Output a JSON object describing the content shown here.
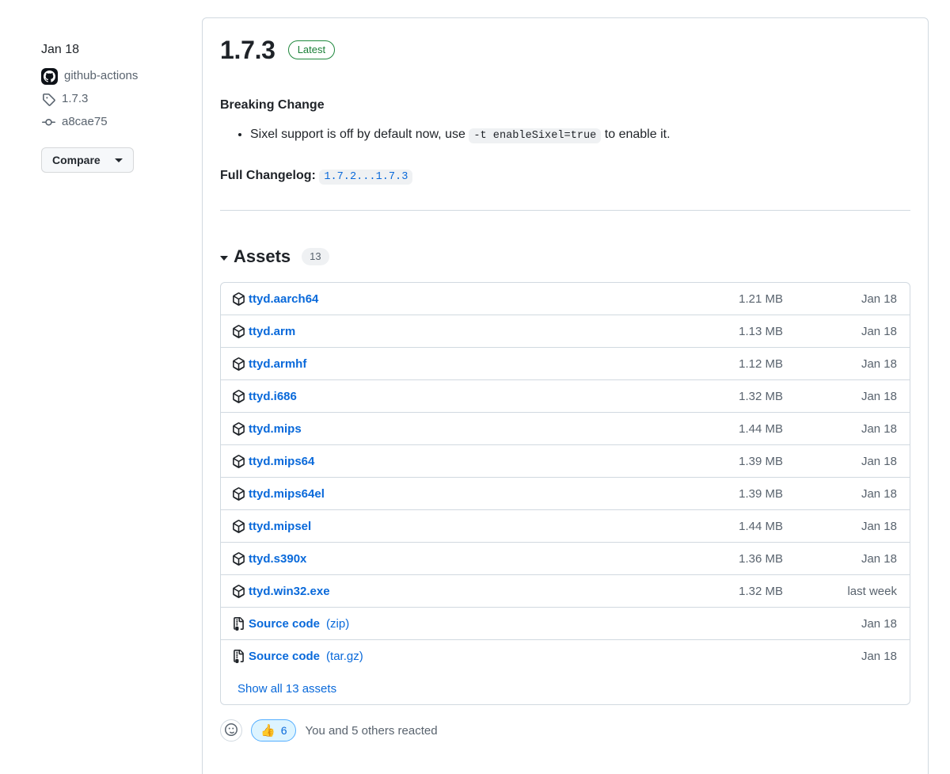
{
  "sidebar": {
    "release_date": "Jan 18",
    "author": "github-actions",
    "tag": "1.7.3",
    "commit": "a8cae75",
    "compare_label": "Compare"
  },
  "release": {
    "version": "1.7.3",
    "latest_badge": "Latest",
    "body_heading": "Breaking Change",
    "change_text_before": "Sixel support is off by default now, use",
    "change_code": "-t enableSixel=true",
    "change_text_after": "to enable it.",
    "changelog_label": "Full Changelog:",
    "changelog_link": "1.7.2...1.7.3"
  },
  "assets": {
    "title": "Assets",
    "count": "13",
    "show_all_label": "Show all 13 assets",
    "rows": [
      {
        "icon": "package-icon",
        "name": "ttyd.aarch64",
        "suffix": "",
        "size": "1.21 MB",
        "date": "Jan 18"
      },
      {
        "icon": "package-icon",
        "name": "ttyd.arm",
        "suffix": "",
        "size": "1.13 MB",
        "date": "Jan 18"
      },
      {
        "icon": "package-icon",
        "name": "ttyd.armhf",
        "suffix": "",
        "size": "1.12 MB",
        "date": "Jan 18"
      },
      {
        "icon": "package-icon",
        "name": "ttyd.i686",
        "suffix": "",
        "size": "1.32 MB",
        "date": "Jan 18"
      },
      {
        "icon": "package-icon",
        "name": "ttyd.mips",
        "suffix": "",
        "size": "1.44 MB",
        "date": "Jan 18"
      },
      {
        "icon": "package-icon",
        "name": "ttyd.mips64",
        "suffix": "",
        "size": "1.39 MB",
        "date": "Jan 18"
      },
      {
        "icon": "package-icon",
        "name": "ttyd.mips64el",
        "suffix": "",
        "size": "1.39 MB",
        "date": "Jan 18"
      },
      {
        "icon": "package-icon",
        "name": "ttyd.mipsel",
        "suffix": "",
        "size": "1.44 MB",
        "date": "Jan 18"
      },
      {
        "icon": "package-icon",
        "name": "ttyd.s390x",
        "suffix": "",
        "size": "1.36 MB",
        "date": "Jan 18"
      },
      {
        "icon": "package-icon",
        "name": "ttyd.win32.exe",
        "suffix": "",
        "size": "1.32 MB",
        "date": "last week"
      },
      {
        "icon": "file-zip-icon",
        "name": "Source code",
        "suffix": "(zip)",
        "size": "",
        "date": "Jan 18"
      },
      {
        "icon": "file-zip-icon",
        "name": "Source code",
        "suffix": "(tar.gz)",
        "size": "",
        "date": "Jan 18"
      }
    ]
  },
  "reactions": {
    "emoji": "👍",
    "count": "6",
    "text": "You and 5 others reacted"
  },
  "colors": {
    "link_blue": "#0969da",
    "latest_green": "#1a7f37",
    "border_gray": "#d1d9e0",
    "muted_text": "#59636e",
    "reaction_bg": "#ddf4ff",
    "reaction_border": "#54aeff"
  }
}
